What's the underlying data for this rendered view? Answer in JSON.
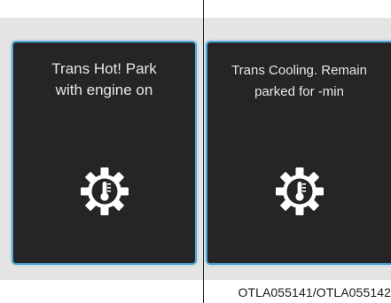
{
  "panels": [
    {
      "line1": "Trans Hot! Park",
      "line2": "with engine on",
      "icon": "transmission-temperature-icon"
    },
    {
      "line1": "Trans Cooling. Remain",
      "line2": "parked for -min",
      "icon": "transmission-temperature-icon"
    }
  ],
  "caption": "OTLA055141/OTLA055142",
  "colors": {
    "screen_bg": "#262424",
    "screen_border": "#4fa8d8",
    "text": "#e8e8e8",
    "page_band": "#e4e4e4"
  }
}
